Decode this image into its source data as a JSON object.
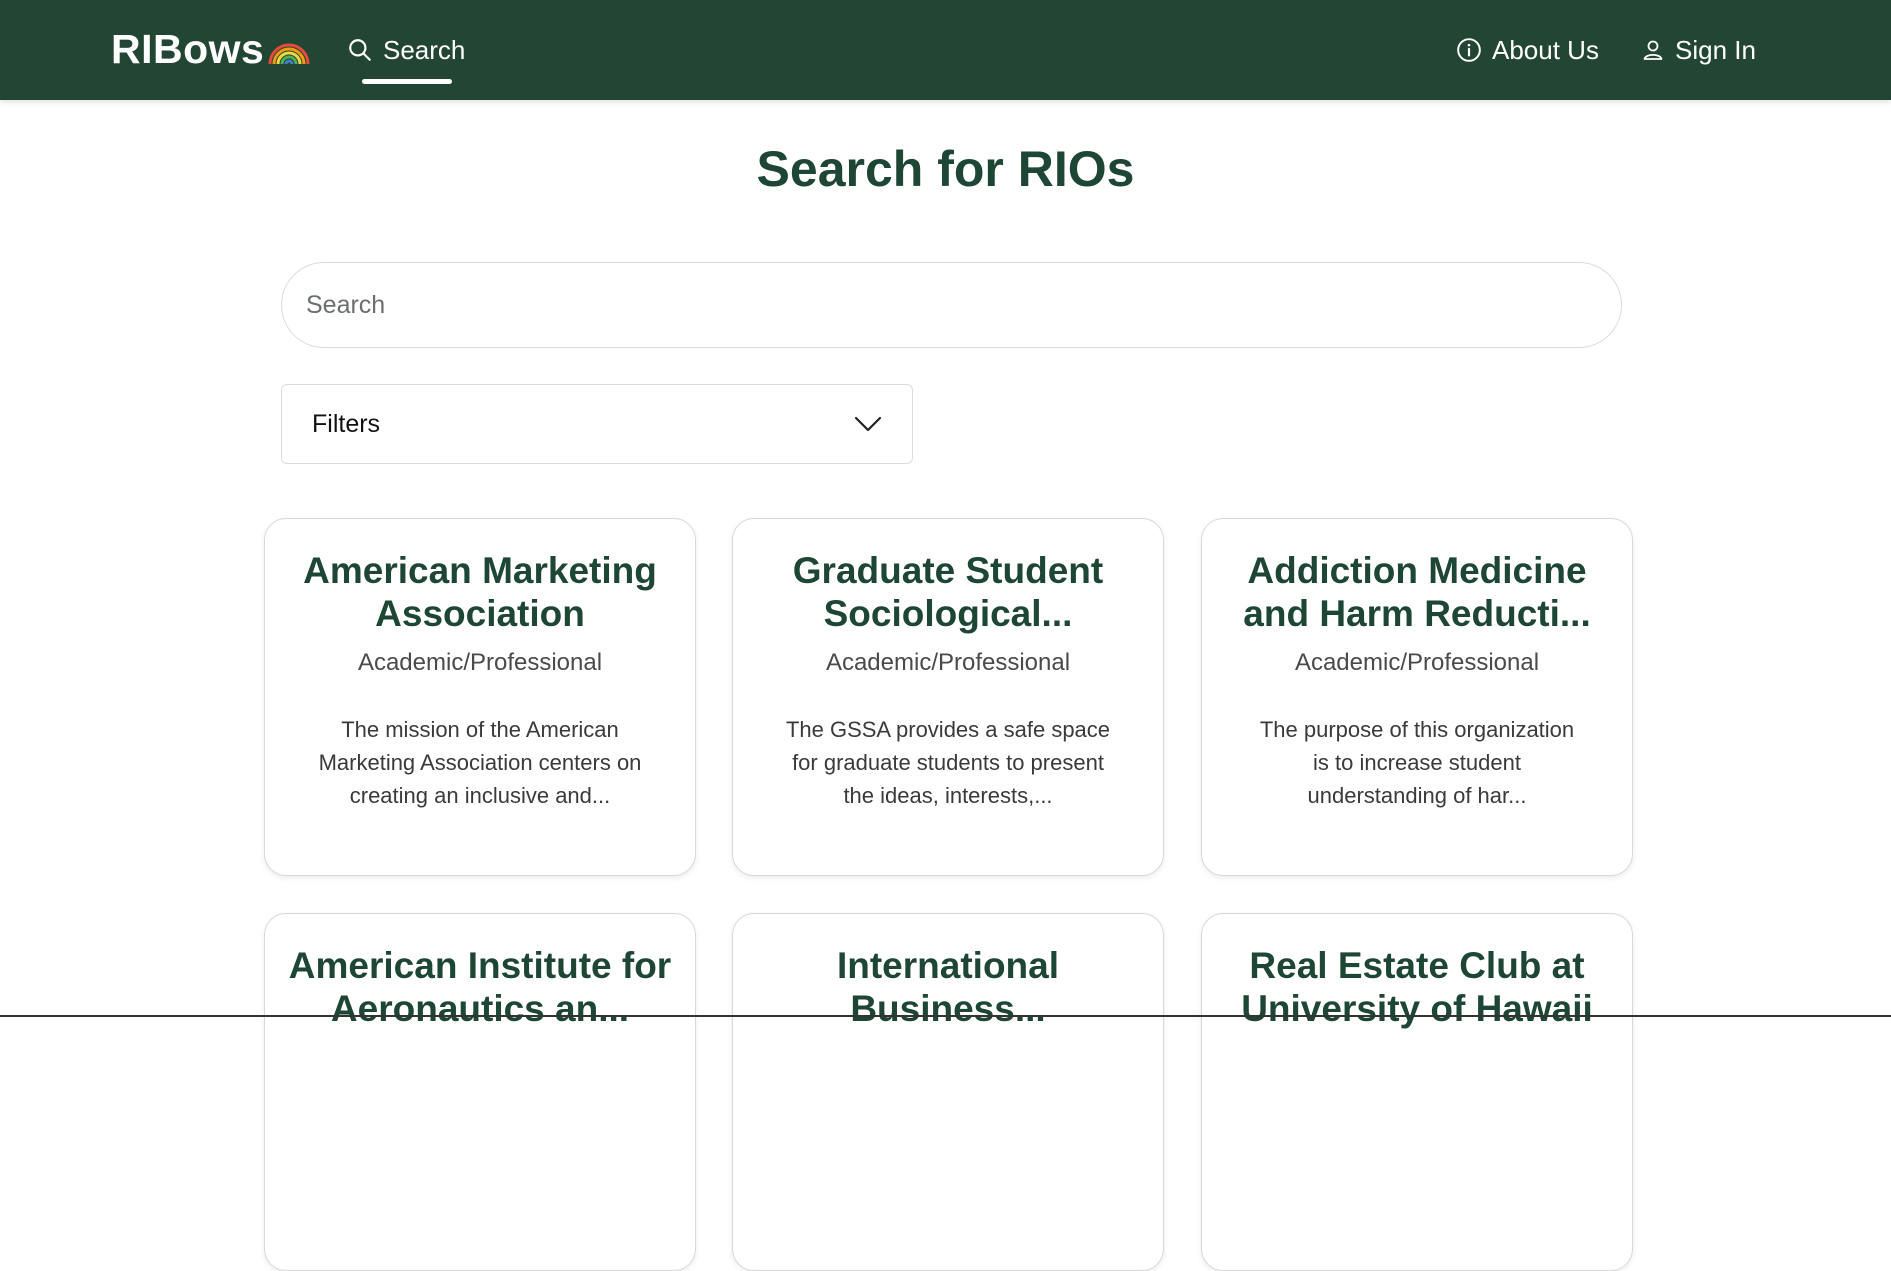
{
  "navbar": {
    "logo_text": "RIBows",
    "search_label": "Search",
    "about_label": "About Us",
    "signin_label": "Sign In",
    "colors": {
      "background": "#234634",
      "text": "#ffffff"
    }
  },
  "main": {
    "title": "Search for RIOs",
    "search_placeholder": "Search",
    "filters_label": "Filters"
  },
  "cards": [
    {
      "title": "American Marketing Association",
      "category": "Academic/Professional",
      "description": "The mission of the American Marketing Association centers on creating an inclusive and..."
    },
    {
      "title": "Graduate Student Sociological...",
      "category": "Academic/Professional",
      "description": "The GSSA provides a safe space for graduate students to present the ideas, interests,..."
    },
    {
      "title": "Addiction Medicine and Harm Reducti...",
      "category": "Academic/Professional",
      "description": "The purpose of this organization is to increase student understanding of har..."
    },
    {
      "title": "American Institute for Aeronautics an...",
      "category": "",
      "description": ""
    },
    {
      "title": "International Business...",
      "category": "",
      "description": ""
    },
    {
      "title": "Real Estate Club at University of Hawaii",
      "category": "",
      "description": ""
    }
  ],
  "icons": {
    "search": "search-icon",
    "about": "info-icon",
    "signin": "user-icon",
    "filters": "chevron-down-icon",
    "logo": "rainbow-icon"
  }
}
